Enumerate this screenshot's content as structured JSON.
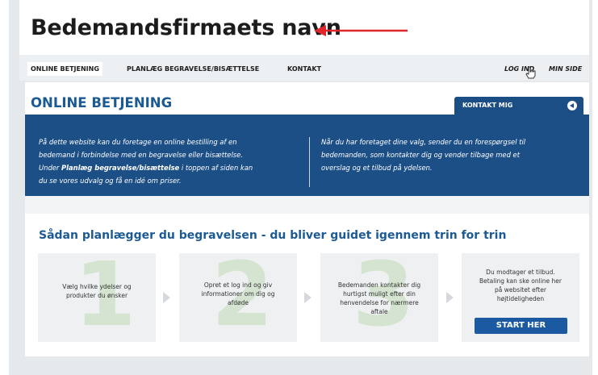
{
  "header": {
    "company_name": "Bedemandsfirmaets navn"
  },
  "nav": {
    "items": [
      {
        "label": "ONLINE BETJENING"
      },
      {
        "label": "PLANLÆG BEGRAVELSE/BISÆTTELSE"
      },
      {
        "label": "KONTAKT"
      }
    ],
    "login": "LOG IND",
    "my_page": "MIN SIDE"
  },
  "main": {
    "title": "ONLINE BETJENING",
    "contact_tab": "KONTAKT MIG",
    "banner": {
      "left_1": "På dette website kan du foretage en online bestilling af en",
      "left_2": "bedemand i forbindelse med en begravelse eller bisættelse.",
      "left_3a": "Under ",
      "left_3b": "Planlæg begravelse/bisættelse",
      "left_3c": " i toppen af siden kan",
      "left_4": "du se vores udvalg og få en idé om priser.",
      "right_1": "Når du har foretaget dine valg, sender du en forespørgsel til",
      "right_2": "bedemanden, som kontakter dig og vender tilbage med et",
      "right_3": "overslag og et tilbud på ydelsen."
    },
    "steps_title": "Sådan planlægger du begravelsen - du bliver guidet igennem trin for trin",
    "steps": [
      {
        "number": "1",
        "line1": "Vælg hvilke ydelser og",
        "line2": "produkter du ønsker",
        "line3": "",
        "line4": ""
      },
      {
        "number": "2",
        "line1": "Opret et log ind og giv",
        "line2": "informationer om dig og",
        "line3": "afdøde",
        "line4": ""
      },
      {
        "number": "3",
        "line1": "Bedemanden kontakter dig",
        "line2": "hurtigst muligt efter din",
        "line3": "henvendelse for nærmere",
        "line4": "aftale"
      },
      {
        "number": "",
        "line1": "Du modtager et tilbud.",
        "line2": "Betaling kan ske online her",
        "line3": "på websitet efter",
        "line4": "højtideligheden"
      }
    ],
    "start_button": "START HER"
  },
  "colors": {
    "brand_blue": "#1c4f86",
    "title_blue": "#1c5a94",
    "arrow_red": "#e0262b"
  }
}
